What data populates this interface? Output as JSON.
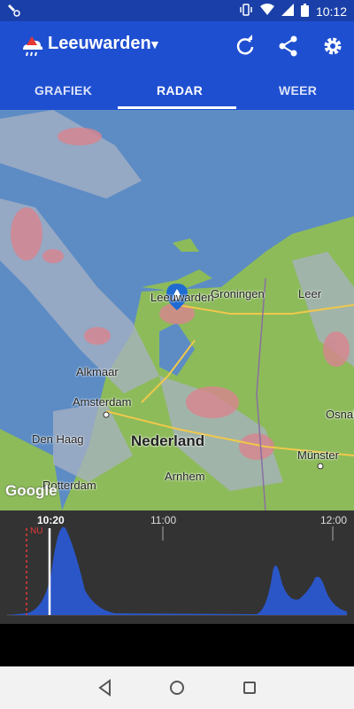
{
  "status": {
    "time": "10:12"
  },
  "appbar": {
    "title": "Leeuwarden",
    "icons": [
      "weather-logo-icon",
      "dropdown-icon",
      "refresh-icon",
      "share-icon",
      "settings-icon"
    ]
  },
  "tabs": [
    {
      "label": "GRAFIEK",
      "selected": false
    },
    {
      "label": "RADAR",
      "selected": true
    },
    {
      "label": "WEER",
      "selected": false
    }
  ],
  "map": {
    "labels": {
      "leeuwarden": "Leeuwarden",
      "groningen": "Groningen",
      "leer": "Leer",
      "alkmaar": "Alkmaar",
      "amsterdam": "Amsterdam",
      "den_haag": "Den Haag",
      "nederland": "Nederland",
      "osnabruck": "Osnal",
      "munster": "Münster",
      "rotterdam": "Rotterdam",
      "arnhem": "Arnhem"
    },
    "attribution": "Google"
  },
  "timeline": {
    "now_label": "NU",
    "current_time": "10:20",
    "tick_11": "11:00",
    "tick_12": "12:00"
  },
  "colors": {
    "primary": "#1f4fd1",
    "status": "#1a3fa8",
    "rain_fill": "#2a56c8"
  }
}
